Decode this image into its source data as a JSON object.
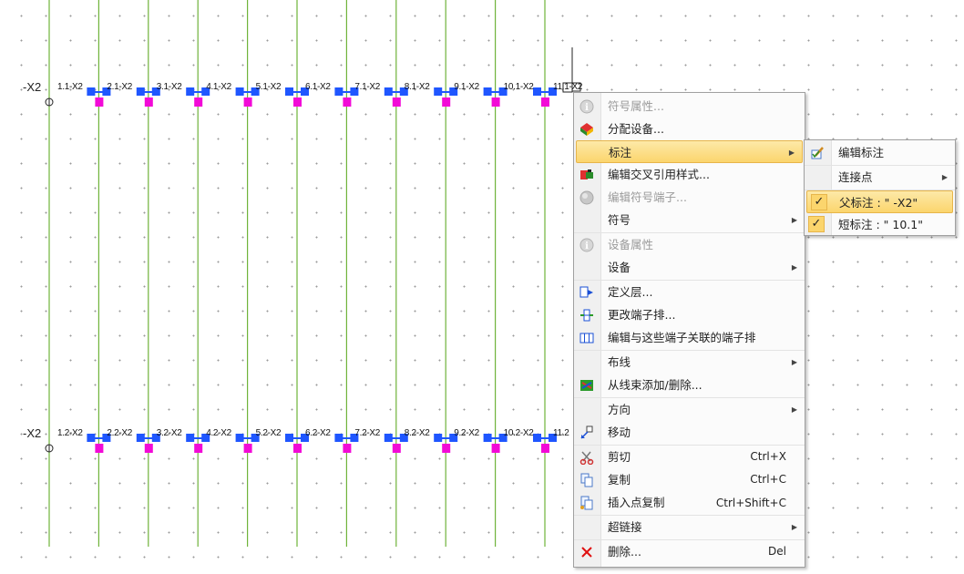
{
  "strips": {
    "top": {
      "label": "-X2",
      "terminal_labels": [
        "1.1-X2",
        "2.1-X2",
        "3.1-X2",
        "4.1-X2",
        "5.1-X2",
        "6.1-X2",
        "7.1-X2",
        "8.1-X2",
        "9.1-X2",
        "10.1-X2",
        "11.1-X2"
      ]
    },
    "bottom": {
      "label": "-X2",
      "terminal_labels": [
        "1.2-X2",
        "2.2-X2",
        "3.2-X2",
        "4.2-X2",
        "5.2-X2",
        "6.2-X2",
        "7.2-X2",
        "8.2-X2",
        "9.2-X2",
        "10.2-X2",
        "11.2"
      ]
    }
  },
  "context_menu": {
    "items": [
      {
        "label": "符号属性...",
        "icon": "info-icon",
        "disabled": true
      },
      {
        "label": "分配设备...",
        "icon": "assign-device-icon"
      },
      {
        "label": "标注",
        "icon": "",
        "submenu": true,
        "highlighted": true
      },
      {
        "label": "编辑交叉引用样式...",
        "icon": "cross-reference-icon"
      },
      {
        "label": "编辑符号端子...",
        "icon": "symbol-terminal-icon",
        "disabled": true
      },
      {
        "label": "符号",
        "icon": "",
        "submenu": true
      },
      {
        "label": "设备属性",
        "icon": "info-icon",
        "disabled": true
      },
      {
        "label": "设备",
        "icon": "",
        "submenu": true
      },
      {
        "label": "定义层...",
        "icon": "define-layer-icon"
      },
      {
        "label": "更改端子排...",
        "icon": "change-terminal-strip-icon"
      },
      {
        "label": "编辑与这些端子关联的端子排",
        "icon": "terminal-strip-icon"
      },
      {
        "label": "布线",
        "icon": "",
        "submenu": true
      },
      {
        "label": "从线束添加/删除...",
        "icon": "harness-icon"
      },
      {
        "label": "方向",
        "icon": "",
        "submenu": true
      },
      {
        "label": "移动",
        "icon": "move-icon"
      },
      {
        "label": "剪切",
        "icon": "cut-icon",
        "shortcut": "Ctrl+X"
      },
      {
        "label": "复制",
        "icon": "copy-icon",
        "shortcut": "Ctrl+C"
      },
      {
        "label": "插入点复制",
        "icon": "paste-icon",
        "shortcut": "Ctrl+Shift+C"
      },
      {
        "label": "超链接",
        "icon": "",
        "submenu": true
      },
      {
        "label": "删除...",
        "icon": "delete-icon",
        "shortcut": "Del"
      }
    ]
  },
  "submenu": {
    "items": [
      {
        "label": "编辑标注",
        "icon": "edit-annotation-icon"
      },
      {
        "label": "连接点",
        "submenu": true
      },
      {
        "label": "父标注 : \" -X2\"",
        "checked": true,
        "highlighted": true
      },
      {
        "label": "短标注 : \" 10.1\"",
        "checked": true
      }
    ]
  },
  "colors": {
    "wire": "#6fb33a",
    "terminal_blue": "#1f56ff",
    "terminal_magenta": "#f20ad7",
    "highlight": "#fbd56d",
    "delete_red": "#e01010"
  }
}
